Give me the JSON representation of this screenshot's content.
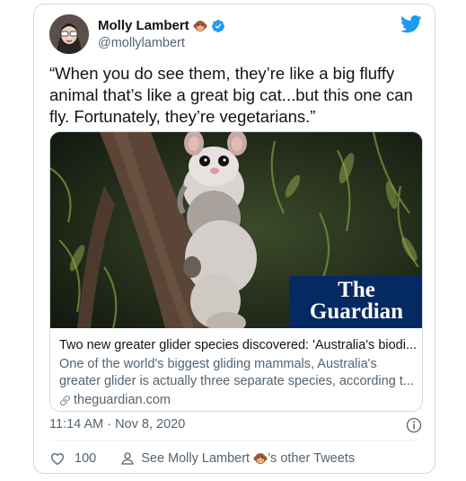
{
  "author": {
    "name": "Molly Lambert",
    "handle": "@mollylambert",
    "name_emoji": "monkey-face",
    "verified": true
  },
  "tweet": {
    "text": "“When you do see them, they’re like a big fluffy animal that’s like a great big cat...but this one can fly. Fortunately, they’re vegetarians.”"
  },
  "link_card": {
    "image_subject": "greater-glider-photo",
    "logo_line1": "The",
    "logo_line2": "Guardian",
    "title": "Two new greater glider species discovered: 'Australia's biodi...",
    "description": "One of the world's biggest gliding mammals, Australia's greater glider is actually three separate species, according t...",
    "domain": "theguardian.com"
  },
  "meta": {
    "timestamp": "11:14 AM · Nov 8, 2020"
  },
  "actions": {
    "like_count": "100",
    "other_tweets_prefix": "See Molly Lambert",
    "other_tweets_suffix": "’s other Tweets"
  },
  "colors": {
    "twitter_blue": "#1d9bf0",
    "guardian_navy": "#052962",
    "secondary_text": "#536471"
  }
}
